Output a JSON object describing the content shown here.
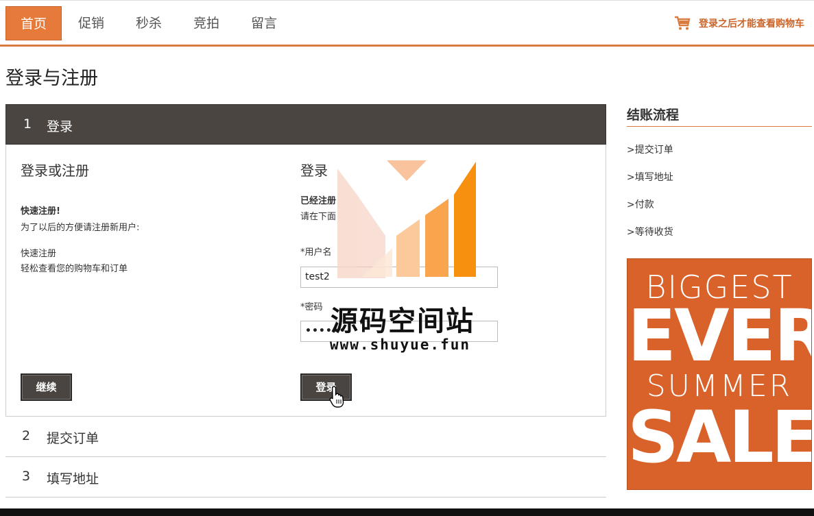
{
  "nav": {
    "items": [
      "首页",
      "促销",
      "秒杀",
      "竞拍",
      "留言"
    ],
    "cart_text": "登录之后才能查看购物车"
  },
  "page_title": "登录与注册",
  "step1": {
    "num": "1",
    "label": "登录",
    "register": {
      "title": "登录或注册",
      "quick_title": "快速注册!",
      "quick_desc": "为了以后的方便请注册新用户:",
      "line1": "快速注册",
      "line2": "轻松查看您的购物车和订单",
      "continue_button": "继续"
    },
    "login": {
      "title": "登录",
      "registered_title": "已经注册",
      "registered_desc": "请在下面",
      "username_label": "*用户名",
      "username_value": "test2",
      "password_label": "*密码",
      "password_value": "••••••",
      "login_button": "登录"
    }
  },
  "steps": [
    {
      "num": "2",
      "label": "提交订单"
    },
    {
      "num": "3",
      "label": "填写地址"
    }
  ],
  "sidebar": {
    "title": "结账流程",
    "items": [
      ">提交订单",
      ">填写地址",
      ">付款",
      ">等待收货"
    ]
  },
  "banner": {
    "line1": "BIGGEST",
    "line2": "EVER",
    "line3": "SUMMER",
    "line4": "SALE"
  },
  "watermark": {
    "name": "源码空间站",
    "url": "www.shuyue.fun"
  },
  "colors": {
    "accent": "#e57a3a",
    "dark": "#4a4541",
    "banner": "#d9612a"
  }
}
